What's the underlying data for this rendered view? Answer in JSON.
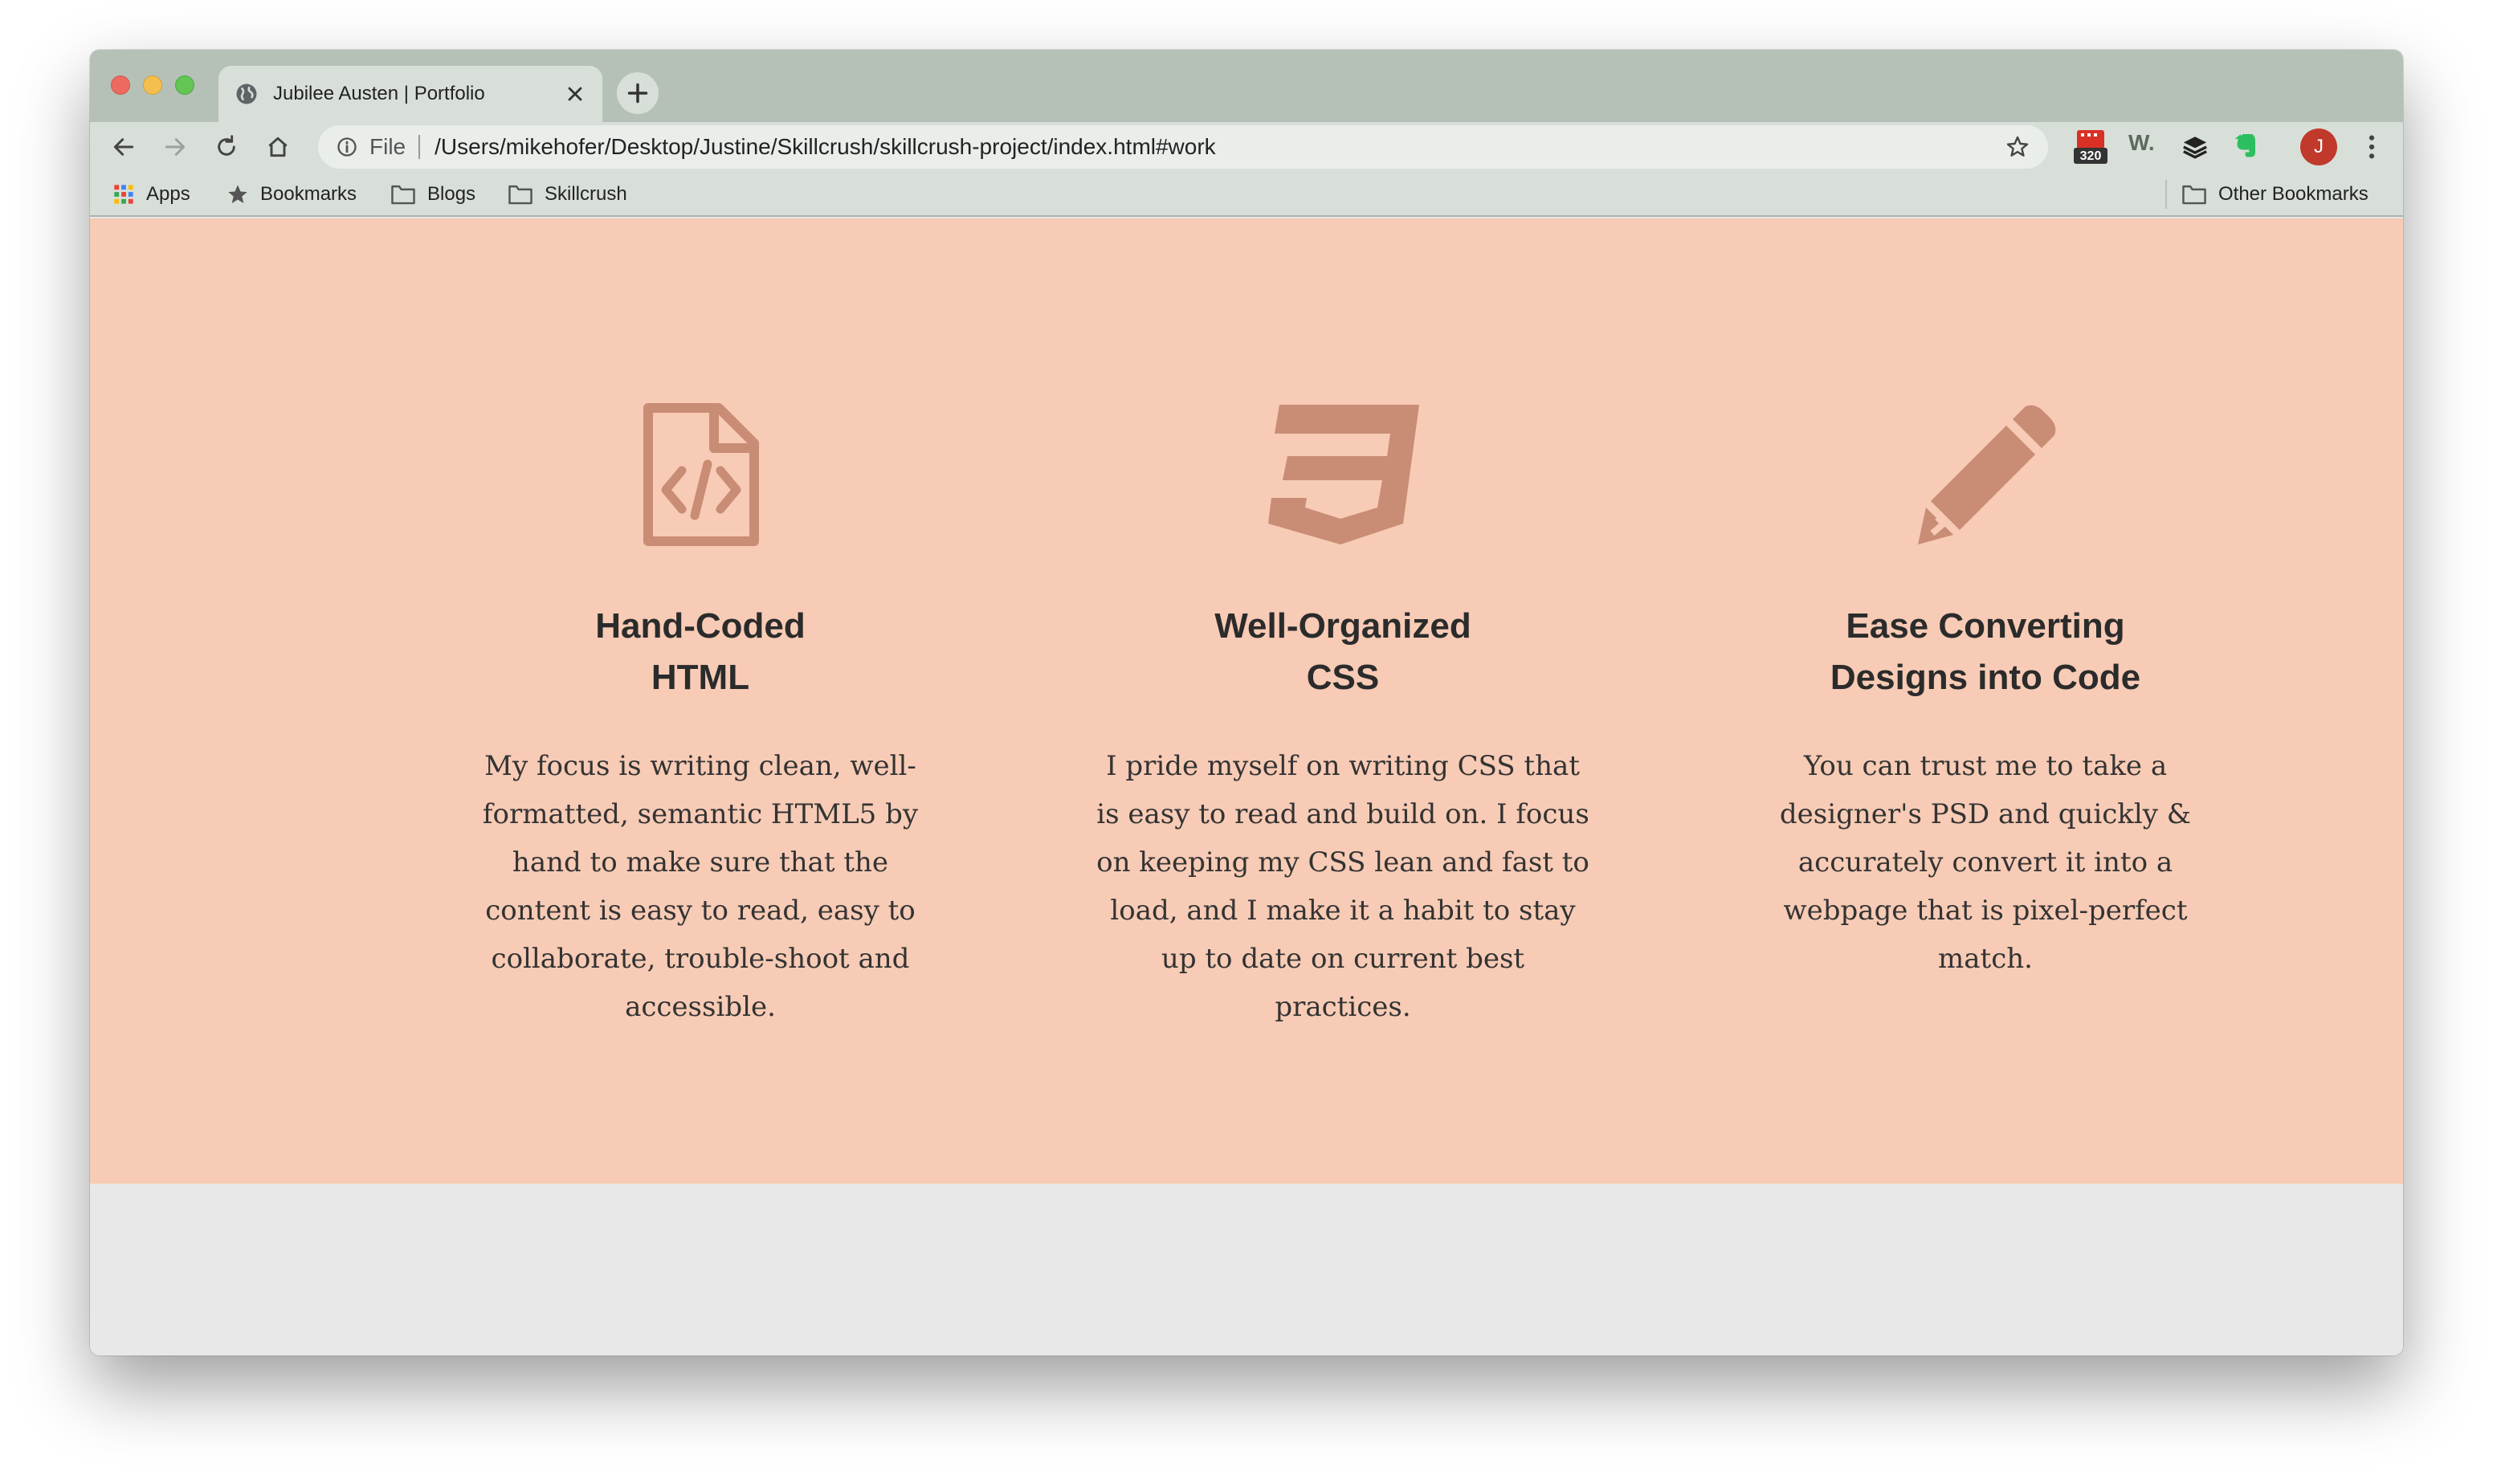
{
  "browser": {
    "tab_title": "Jubilee Austen | Portfolio",
    "file_label": "File",
    "url": "/Users/mikehofer/Desktop/Justine/Skillcrush/skillcrush-project/index.html#work",
    "extension_badge": "320",
    "extension_w": "W.",
    "profile_initial": "J"
  },
  "bookmarks": {
    "apps": "Apps",
    "bookmarks": "Bookmarks",
    "blogs": "Blogs",
    "skillcrush": "Skillcrush",
    "other": "Other Bookmarks"
  },
  "colors": {
    "work_background": "#f7cbb5",
    "icon_color": "#c98c74",
    "footer_background": "#e8e8e8"
  },
  "features": [
    {
      "icon": "html-file-code-icon",
      "title_line1": "Hand-Coded",
      "title_line2": "HTML",
      "body": "My focus is writing clean, well-formatted, semantic HTML5 by hand to make sure that the content is easy to read, easy to collaborate, trouble-shoot and accessible."
    },
    {
      "icon": "css3-icon",
      "title_line1": "Well-Organized",
      "title_line2": "CSS",
      "body": "I pride myself on writing CSS that is easy to read and build on. I focus on keeping my CSS lean and fast to load, and I make it a habit to stay up to date on current best practices."
    },
    {
      "icon": "pencil-icon",
      "title_line1": "Ease Converting",
      "title_line2": "Designs into Code",
      "body": "You can trust me to take a designer's PSD and quickly & accurately convert it into a webpage that is pixel-perfect match."
    }
  ]
}
